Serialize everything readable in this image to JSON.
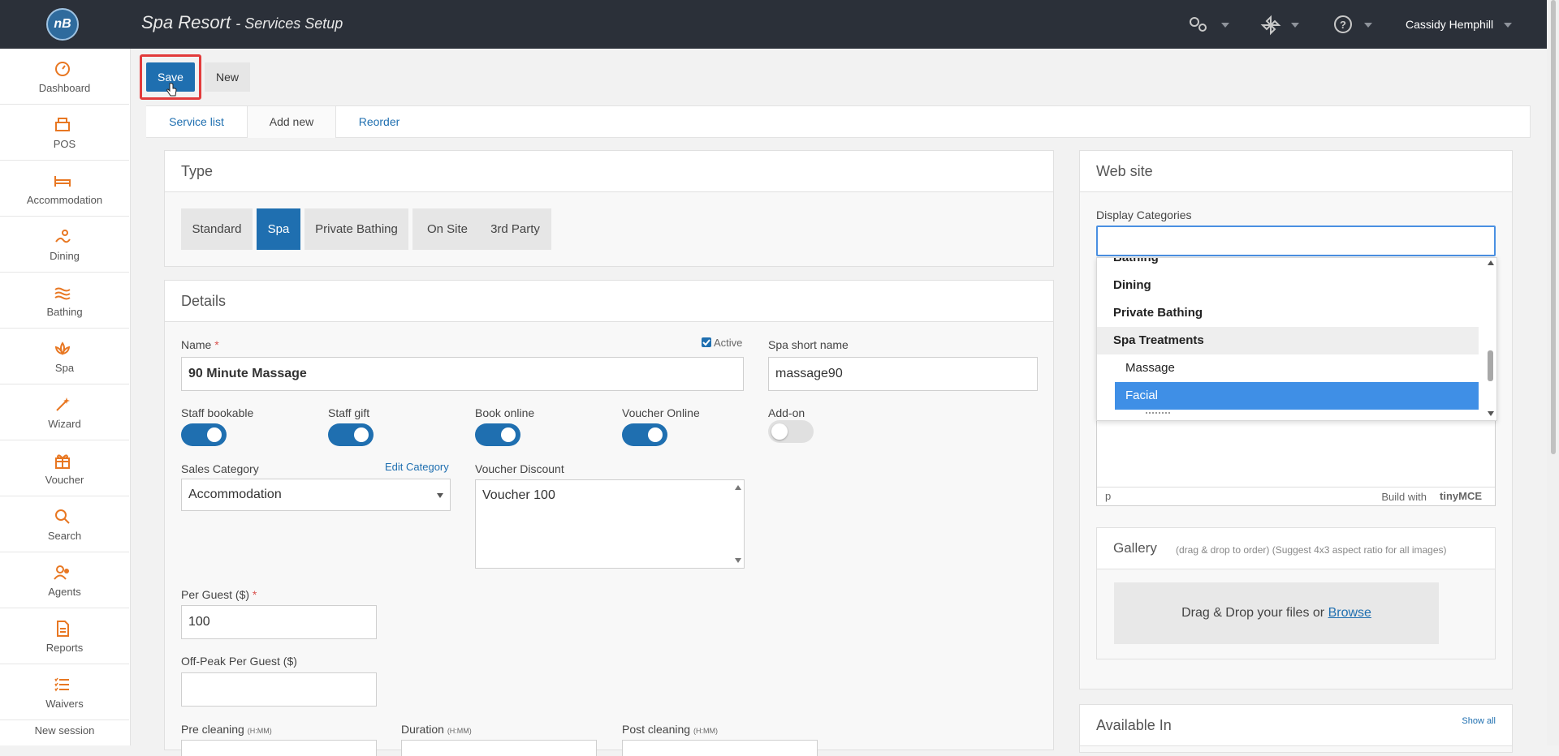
{
  "header": {
    "logo_text": "nB",
    "title": "Spa Resort",
    "subtitle": "Services Setup",
    "user_name": "Cassidy Hemphill",
    "icons": [
      "settings-icon",
      "plugin-icon",
      "help-icon"
    ]
  },
  "sidebar": {
    "items": [
      {
        "label": "Dashboard",
        "icon": "dashboard-icon"
      },
      {
        "label": "POS",
        "icon": "pos-icon"
      },
      {
        "label": "Accommodation",
        "icon": "bed-icon"
      },
      {
        "label": "Dining",
        "icon": "dining-icon"
      },
      {
        "label": "Bathing",
        "icon": "bathing-icon"
      },
      {
        "label": "Spa",
        "icon": "spa-icon"
      },
      {
        "label": "Wizard",
        "icon": "wand-icon"
      },
      {
        "label": "Voucher",
        "icon": "gift-icon"
      },
      {
        "label": "Search",
        "icon": "search-icon"
      },
      {
        "label": "Agents",
        "icon": "agents-icon"
      },
      {
        "label": "Reports",
        "icon": "reports-icon"
      },
      {
        "label": "Waivers",
        "icon": "list-icon"
      }
    ],
    "new_session": "New session"
  },
  "toolbar": {
    "save_label": "Save",
    "new_label": "New"
  },
  "tabs": [
    {
      "label": "Service list"
    },
    {
      "label": "Add new"
    },
    {
      "label": "Reorder"
    }
  ],
  "type_panel": {
    "title": "Type",
    "options": [
      "Standard",
      "Spa",
      "Private Bathing",
      "On Site",
      "3rd Party"
    ],
    "selected": "Spa"
  },
  "details": {
    "title": "Details",
    "name_label": "Name",
    "name_value": "90 Minute Massage",
    "active_label": "Active",
    "short_name_label": "Spa short name",
    "short_name_value": "massage90",
    "toggles": [
      {
        "label": "Staff bookable",
        "on": true
      },
      {
        "label": "Staff gift",
        "on": true
      },
      {
        "label": "Book online",
        "on": true
      },
      {
        "label": "Voucher Online",
        "on": true
      },
      {
        "label": "Add-on",
        "on": false
      }
    ],
    "sales_category_label": "Sales Category",
    "edit_category_link": "Edit Category",
    "sales_category_value": "Accommodation",
    "voucher_discount_label": "Voucher Discount",
    "voucher_discount_value": "Voucher 100",
    "per_guest_label": "Per Guest ($)",
    "per_guest_value": "100",
    "offpeak_label": "Off-Peak Per Guest ($)",
    "offpeak_value": "",
    "pre_cleaning_label": "Pre cleaning",
    "duration_label": "Duration",
    "post_cleaning_label": "Post cleaning",
    "time_hint": "(H:MM)"
  },
  "website": {
    "title": "Web site",
    "display_categories_label": "Display Categories",
    "dropdown_items": [
      {
        "label": "Bathing",
        "kind": "grp"
      },
      {
        "label": "Dining",
        "kind": "grp"
      },
      {
        "label": "Private Bathing",
        "kind": "grp"
      },
      {
        "label": "Spa Treatments",
        "kind": "grp hov"
      },
      {
        "label": "Massage",
        "kind": "sub"
      },
      {
        "label": "Facial",
        "kind": "sub act"
      }
    ],
    "editor_status": "p",
    "editor_brand": "Build with",
    "editor_brand_name": "tinyMCE",
    "gallery_title": "Gallery",
    "gallery_hint": "(drag & drop to order) (Suggest 4x3 aspect ratio for all images)",
    "drop_text": "Drag & Drop your files or",
    "browse_link": "Browse",
    "available_in_title": "Available In",
    "show_all_link": "Show all"
  },
  "colors": {
    "accent": "#1f6fb0",
    "topbar": "#2b3039",
    "sidebar_icon": "#e87722",
    "highlight": "#e23b3b"
  }
}
